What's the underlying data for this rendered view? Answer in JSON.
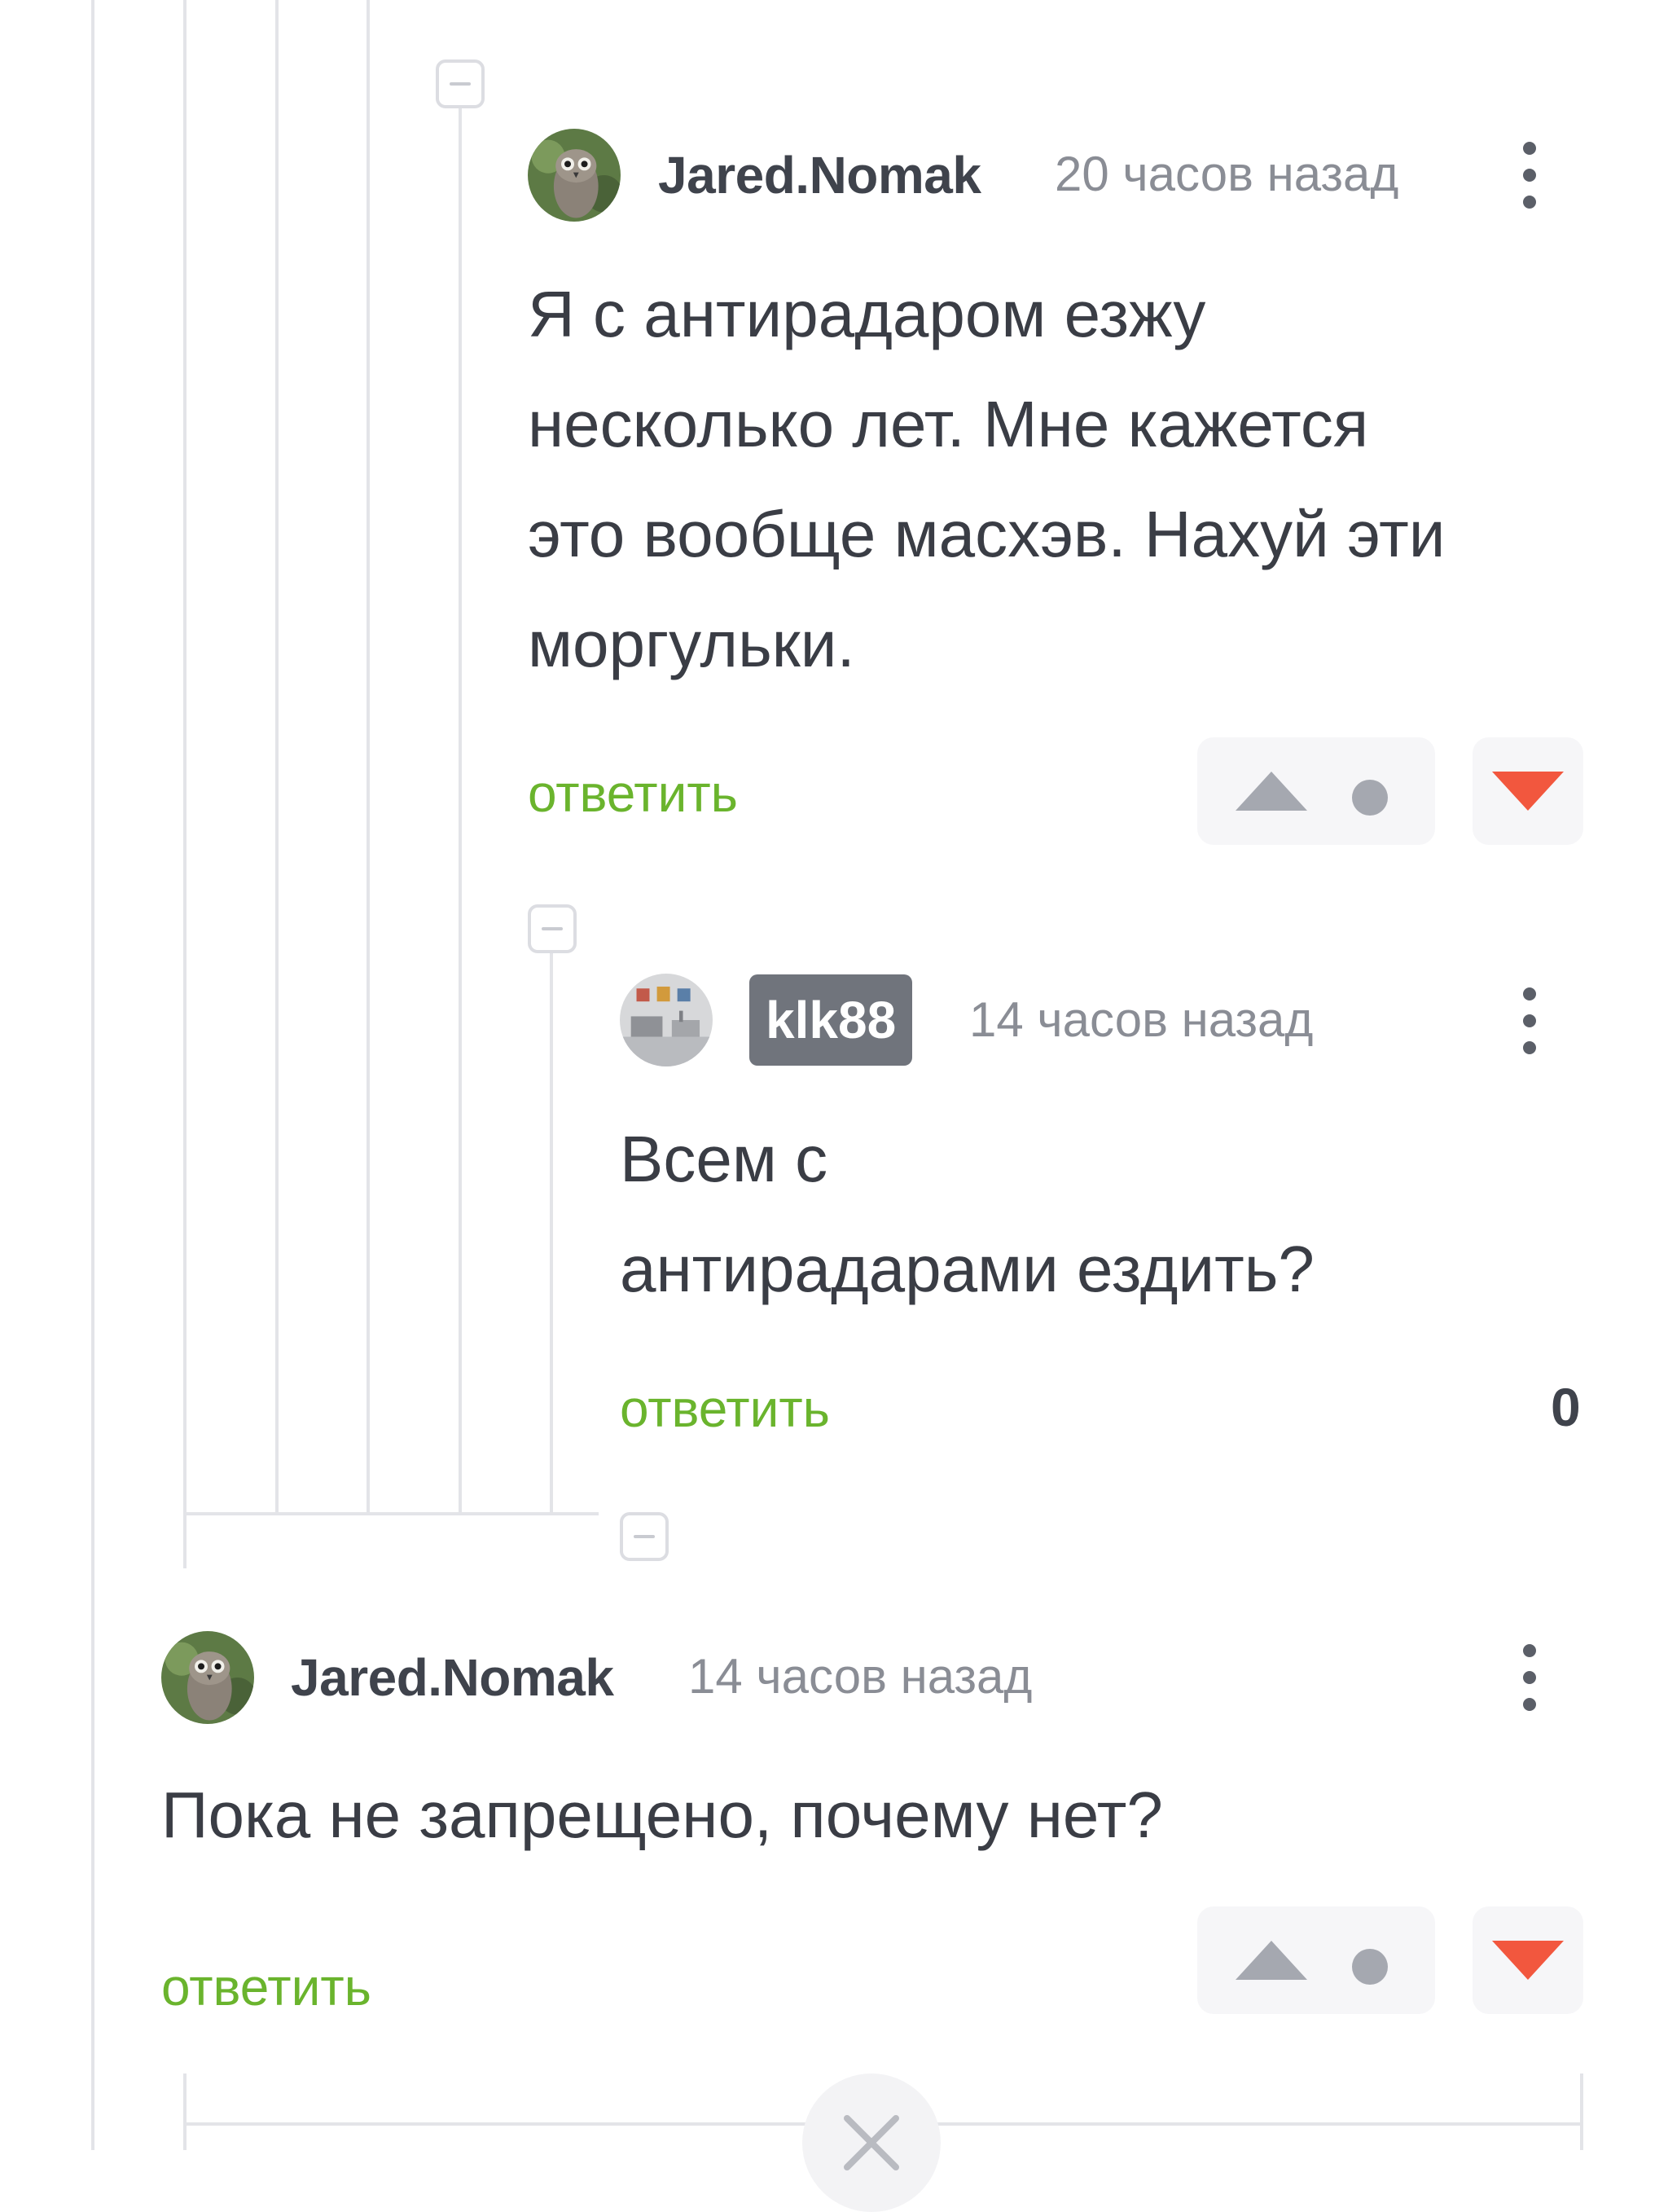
{
  "comments": [
    {
      "username": "Jared.Nomak",
      "time": "20 часов назад",
      "text_lines": [
        "Я с антирадаром езжу",
        "несколько лет. Мне кажется",
        "это вообще масхэв. Нахуй эти",
        "моргульки."
      ],
      "reply_label": "ответить",
      "avatar_icon": "owl-avatar"
    },
    {
      "username": "klk88",
      "time": "14 часов назад",
      "text_lines": [
        "Всем с",
        "антирадарами ездить?"
      ],
      "reply_label": "ответить",
      "score": "0",
      "avatar_icon": "room-avatar"
    },
    {
      "username": "Jared.Nomak",
      "time": "14 часов назад",
      "text_lines": [
        "Пока не запрещено, почему нет?"
      ],
      "reply_label": "ответить",
      "avatar_icon": "owl-avatar"
    }
  ],
  "colors": {
    "reply_link": "#6ab42d",
    "downvote": "#f2573e",
    "upvote": "#a5a8b0",
    "badge_bg": "#70747c"
  }
}
